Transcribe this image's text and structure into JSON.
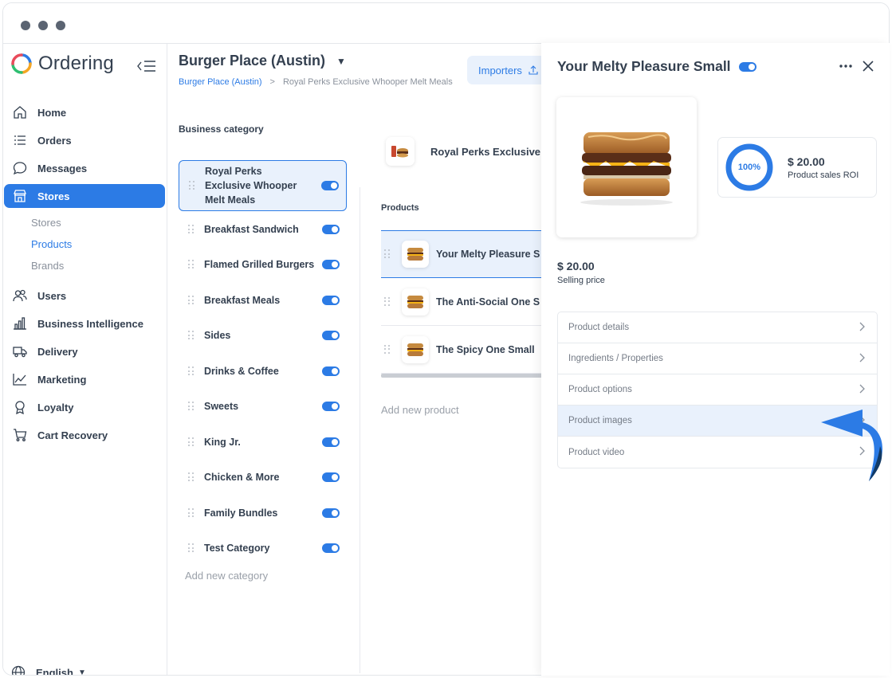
{
  "app": {
    "name": "Ordering"
  },
  "sidebar": {
    "items": [
      {
        "label": "Home",
        "icon": "home-icon"
      },
      {
        "label": "Orders",
        "icon": "list-icon"
      },
      {
        "label": "Messages",
        "icon": "message-icon"
      },
      {
        "label": "Stores",
        "icon": "store-icon",
        "active": true
      },
      {
        "label": "Users",
        "icon": "users-icon"
      },
      {
        "label": "Business Intelligence",
        "icon": "bar-chart-icon"
      },
      {
        "label": "Delivery",
        "icon": "truck-icon"
      },
      {
        "label": "Marketing",
        "icon": "trend-icon"
      },
      {
        "label": "Loyalty",
        "icon": "award-icon"
      },
      {
        "label": "Cart Recovery",
        "icon": "cart-icon"
      }
    ],
    "subitems": [
      {
        "label": "Stores"
      },
      {
        "label": "Products",
        "active": true
      },
      {
        "label": "Brands"
      }
    ],
    "language": "English"
  },
  "header": {
    "store_title": "Burger Place (Austin)",
    "breadcrumb": {
      "store": "Burger Place (Austin)",
      "separator": ">",
      "current": "Royal Perks Exclusive Whooper Melt Meals"
    },
    "importers_label": "Importers"
  },
  "categories": {
    "label": "Business category",
    "items": [
      {
        "name": "Royal Perks Exclusive Whooper Melt Meals",
        "enabled": true,
        "active": true
      },
      {
        "name": "Breakfast Sandwich",
        "enabled": true
      },
      {
        "name": "Flamed Grilled Burgers",
        "enabled": true
      },
      {
        "name": "Breakfast Meals",
        "enabled": true
      },
      {
        "name": "Sides",
        "enabled": true
      },
      {
        "name": "Drinks & Coffee",
        "enabled": true
      },
      {
        "name": "Sweets",
        "enabled": true
      },
      {
        "name": "King Jr.",
        "enabled": true
      },
      {
        "name": "Chicken & More",
        "enabled": true
      },
      {
        "name": "Family Bundles",
        "enabled": true
      },
      {
        "name": "Test Category",
        "enabled": true
      }
    ],
    "add_label": "Add new category"
  },
  "products": {
    "category_header": "Royal Perks Exclusive W",
    "label": "Products",
    "items": [
      {
        "name": "Your Melty Pleasure S",
        "active": true
      },
      {
        "name": "The Anti-Social One S"
      },
      {
        "name": "The Spicy One Small"
      }
    ],
    "add_label": "Add new product"
  },
  "panel": {
    "title": "Your Melty Pleasure Small",
    "roi": {
      "percent": "100%",
      "price": "$ 20.00",
      "label": "Product sales ROI"
    },
    "selling_price": "$ 20.00",
    "selling_label": "Selling price",
    "options": [
      {
        "label": "Product details"
      },
      {
        "label": "Ingredients / Properties"
      },
      {
        "label": "Product options"
      },
      {
        "label": "Product images",
        "active": true
      },
      {
        "label": "Product video"
      }
    ]
  },
  "colors": {
    "accent": "#2c7be5",
    "active_bg": "#e9f1fc",
    "text": "#344050",
    "muted": "#8a919c",
    "arrow": "#2c7be5"
  }
}
